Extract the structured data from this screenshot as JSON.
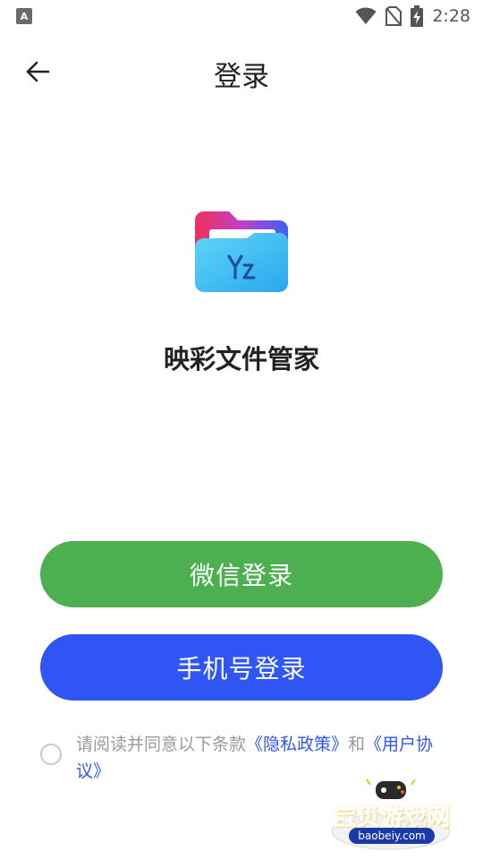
{
  "status_bar": {
    "left_icon_glyph": "A",
    "time": "2:28",
    "icons": [
      "wifi-icon",
      "no-sim-icon",
      "battery-charging-icon"
    ]
  },
  "header": {
    "title": "登录",
    "back_icon": "arrow-left-icon"
  },
  "app": {
    "name": "映彩文件管家",
    "logo_icon": "folder-logo-icon"
  },
  "actions": {
    "wechat_login_label": "微信登录",
    "phone_login_label": "手机号登录"
  },
  "agreement": {
    "prefix": "请阅读并同意以下条款",
    "privacy_link": "《隐私政策》",
    "conjunction": "和",
    "user_agreement_link": "《用户协议》",
    "checked": false
  },
  "watermark": {
    "text": "宝贝游戏网",
    "url": "baobeiy.com"
  },
  "colors": {
    "wechat_green": "#4caf50",
    "primary_blue": "#2f55f5",
    "text_dark": "#222222",
    "text_muted": "#9a9a9a"
  }
}
